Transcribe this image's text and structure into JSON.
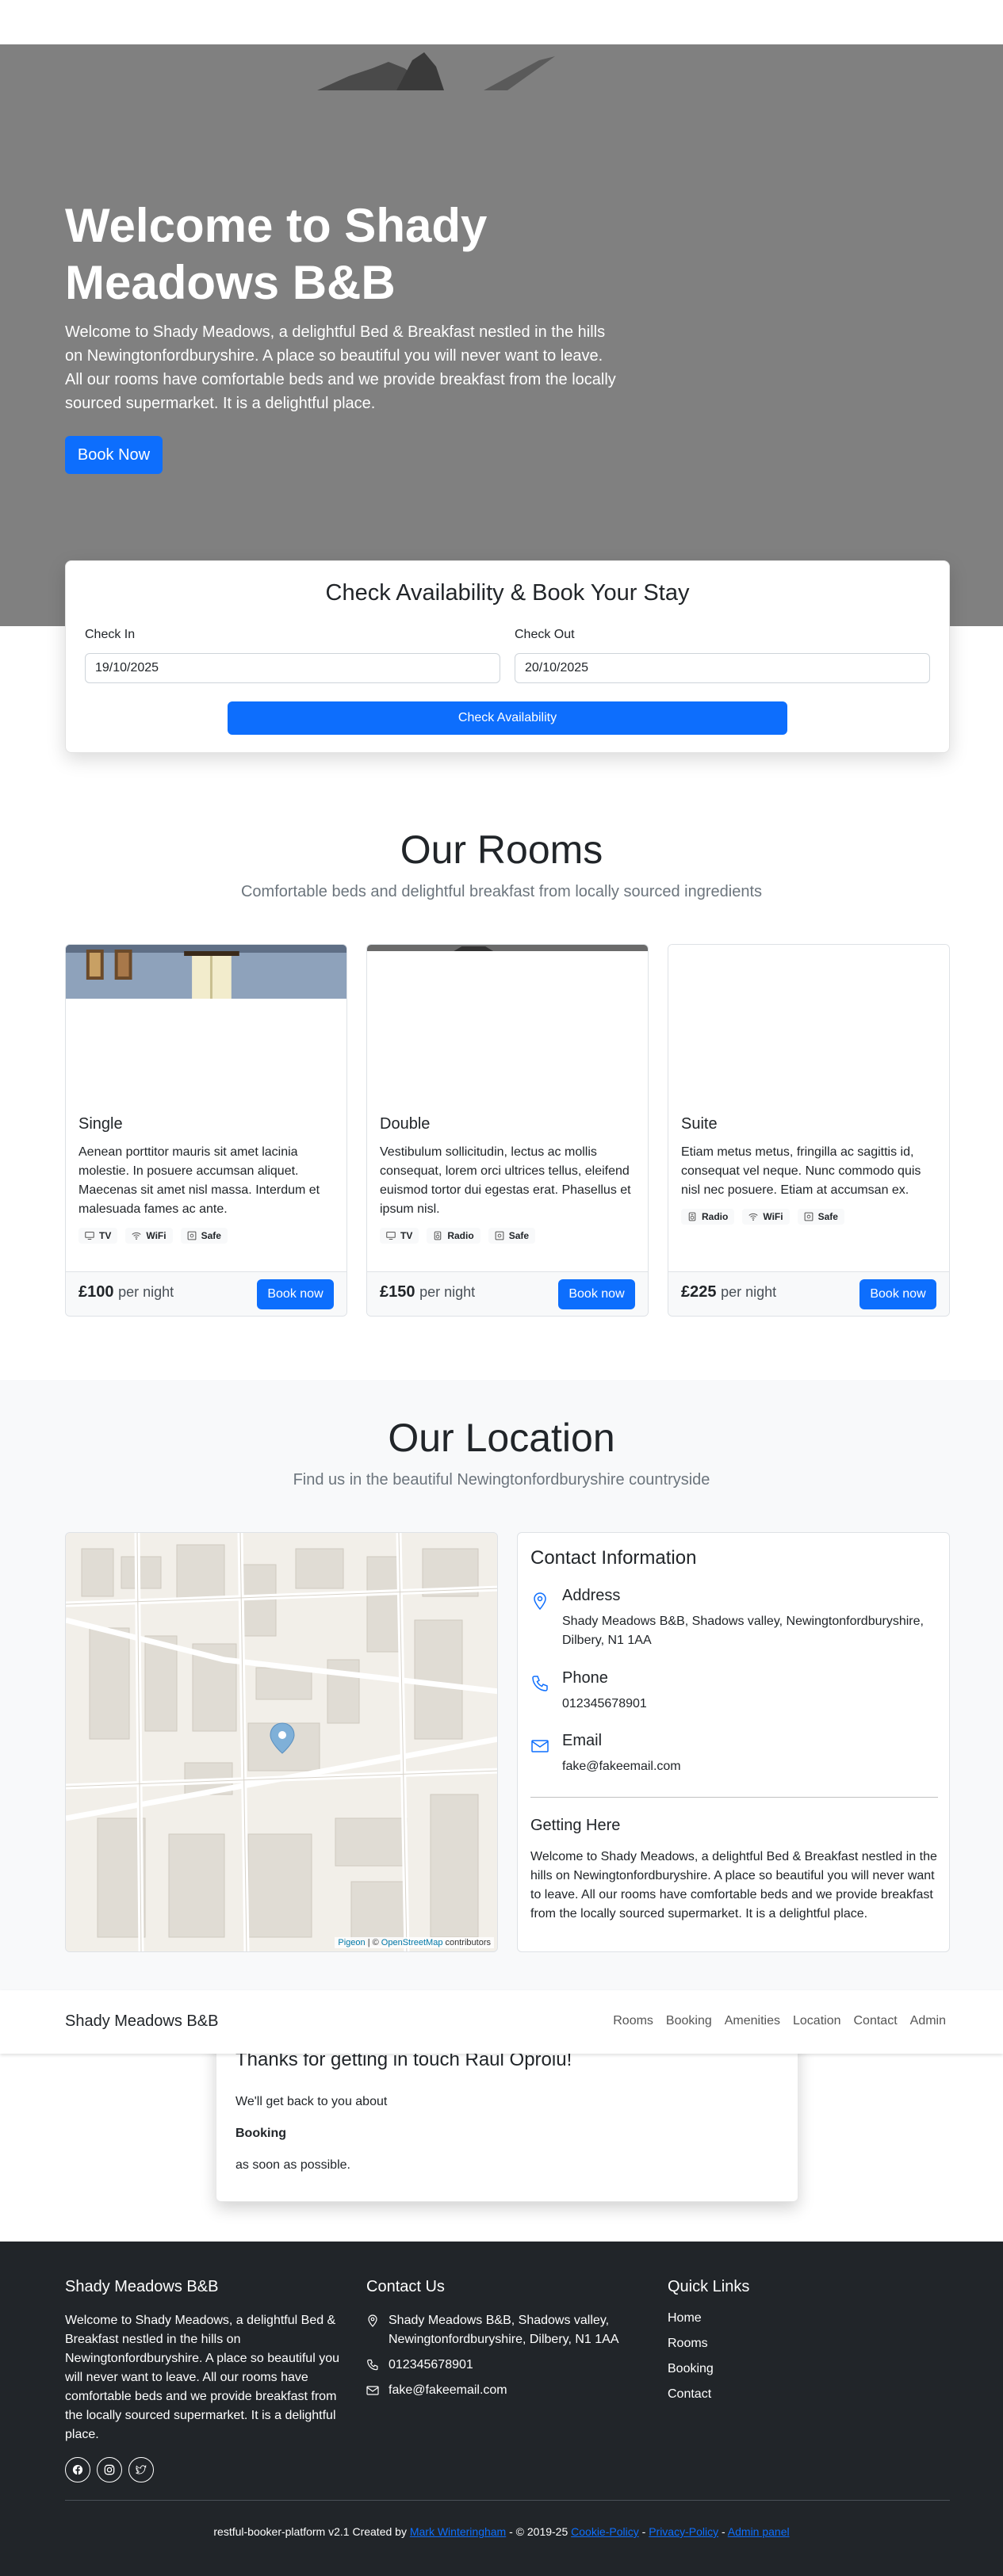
{
  "hero": {
    "title": "Welcome to Shady Meadows B&B",
    "lead": "Welcome to Shady Meadows, a delightful Bed & Breakfast nestled in the hills on Newingtonfordburyshire. A place so beautiful you will never want to leave. All our rooms have comfortable beds and we provide breakfast from the locally sourced supermarket. It is a delightful place.",
    "button": "Book Now",
    "background_color": "#808080"
  },
  "booking": {
    "title": "Check Availability & Book Your Stay",
    "check_in_label": "Check In",
    "check_in_value": "19/10/2025",
    "check_out_label": "Check Out",
    "check_out_value": "20/10/2025",
    "button": "Check Availability"
  },
  "rooms": {
    "title": "Our Rooms",
    "subtitle": "Comfortable beds and delightful breakfast from locally sourced ingredients",
    "price_suffix": "per night",
    "book_label": "Book now",
    "items": [
      {
        "name": "Single",
        "description": "Aenean porttitor mauris sit amet lacinia molestie. In posuere accumsan aliquet. Maecenas sit amet nisl massa. Interdum et malesuada fames ac ante.",
        "amenities": [
          {
            "icon": "tv-icon",
            "label": "TV"
          },
          {
            "icon": "wifi-icon",
            "label": "WiFi"
          },
          {
            "icon": "safe-icon",
            "label": "Safe"
          }
        ],
        "price": "£100"
      },
      {
        "name": "Double",
        "description": "Vestibulum sollicitudin, lectus ac mollis consequat, lorem orci ultrices tellus, eleifend euismod tortor dui egestas erat. Phasellus et ipsum nisl.",
        "amenities": [
          {
            "icon": "tv-icon",
            "label": "TV"
          },
          {
            "icon": "radio-icon",
            "label": "Radio"
          },
          {
            "icon": "safe-icon",
            "label": "Safe"
          }
        ],
        "price": "£150"
      },
      {
        "name": "Suite",
        "description": "Etiam metus metus, fringilla ac sagittis id, consequat vel neque. Nunc commodo quis nisl nec posuere. Etiam at accumsan ex.",
        "amenities": [
          {
            "icon": "radio-icon",
            "label": "Radio"
          },
          {
            "icon": "wifi-icon",
            "label": "WiFi"
          },
          {
            "icon": "safe-icon",
            "label": "Safe"
          }
        ],
        "price": "£225"
      }
    ]
  },
  "location": {
    "title": "Our Location",
    "subtitle": "Find us in the beautiful Newingtonfordburyshire countryside",
    "map_attribution": {
      "leaflet": "Pigeon",
      "separator": "| ©",
      "osm": "OpenStreetMap",
      "suffix": "contributors"
    },
    "contact_title": "Contact Information",
    "address_label": "Address",
    "address_value": "Shady Meadows B&B, Shadows valley, Newingtonfordburyshire, Dilbery, N1 1AA",
    "phone_label": "Phone",
    "phone_value": "012345678901",
    "email_label": "Email",
    "email_value": "fake@fakeemail.com",
    "getting_title": "Getting Here",
    "getting_text": "Welcome to Shady Meadows, a delightful Bed & Breakfast nestled in the hills on Newingtonfordburyshire. A place so beautiful you will never want to leave. All our rooms have comfortable beds and we provide breakfast from the locally sourced supermarket. It is a delightful place."
  },
  "navbar": {
    "brand": "Shady Meadows B&B",
    "links": [
      "Rooms",
      "Booking",
      "Amenities",
      "Location",
      "Contact",
      "Admin"
    ]
  },
  "thanks": {
    "title": "Thanks for getting in touch Raul Oproiu!",
    "line1": "We'll get back to you about",
    "subject": "Booking",
    "line3": "as soon as possible."
  },
  "footer": {
    "brand": "Shady Meadows B&B",
    "about": "Welcome to Shady Meadows, a delightful Bed & Breakfast nestled in the hills on Newingtonfordburyshire. A place so beautiful you will never want to leave. All our rooms have comfortable beds and we provide breakfast from the locally sourced supermarket. It is a delightful place.",
    "contact_title": "Contact Us",
    "address": "Shady Meadows B&B, Shadows valley, Newingtonfordburyshire, Dilbery, N1 1AA",
    "phone": "012345678901",
    "email": "fake@fakeemail.com",
    "quick_title": "Quick Links",
    "quick_links": [
      "Home",
      "Rooms",
      "Booking",
      "Contact"
    ],
    "bottom": {
      "prefix": "restful-booker-platform v2.1 Created by",
      "author": "Mark Winteringham",
      "copyright": "- © 2019-25",
      "cookie": "Cookie-Policy",
      "dash": "-",
      "privacy": "Privacy-Policy",
      "admin": "Admin panel"
    }
  }
}
